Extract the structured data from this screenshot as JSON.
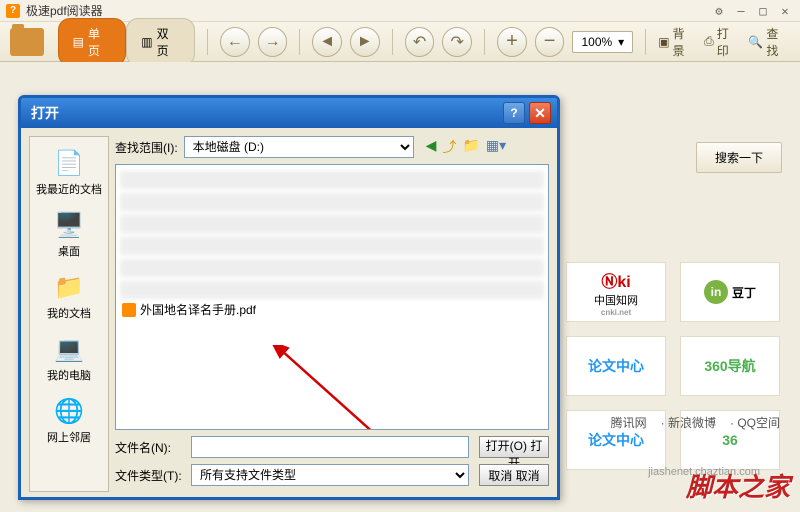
{
  "app": {
    "title": "极速pdf阅读器"
  },
  "toolbar": {
    "tab_single": "单页",
    "tab_double": "双页",
    "zoom": "100%",
    "bg": "背景",
    "print": "打印",
    "find": "查找"
  },
  "right": {
    "search_btn": "搜索一下",
    "tiles": {
      "cnki": "中国知网",
      "cnki_sub": "cnki.net",
      "docin": "豆丁",
      "lunwen": "论文中心",
      "nav360": "360导航",
      "lunwen2": "论文中心",
      "nav36": "36"
    },
    "links": {
      "tencent": "腾讯网",
      "weibo": "· 新浪微博",
      "qzone": "· QQ空间"
    }
  },
  "dialog": {
    "title": "打开",
    "look_in_label": "查找范围(I):",
    "look_in_value": "本地磁盘 (D:)",
    "places": {
      "recent": "我最近的文档",
      "desktop": "桌面",
      "mydocs": "我的文档",
      "mycomputer": "我的电脑",
      "network": "网上邻居"
    },
    "file_item": "外国地名译名手册.pdf",
    "filename_label": "文件名(N):",
    "filetype_label": "文件类型(T):",
    "filetype_value": "所有支持文件类型",
    "open_btn": "打开(O) 打开",
    "cancel_btn": "取消   取消"
  },
  "watermark": "脚本之家",
  "watermark2": "jiashenet.chaztian.com"
}
